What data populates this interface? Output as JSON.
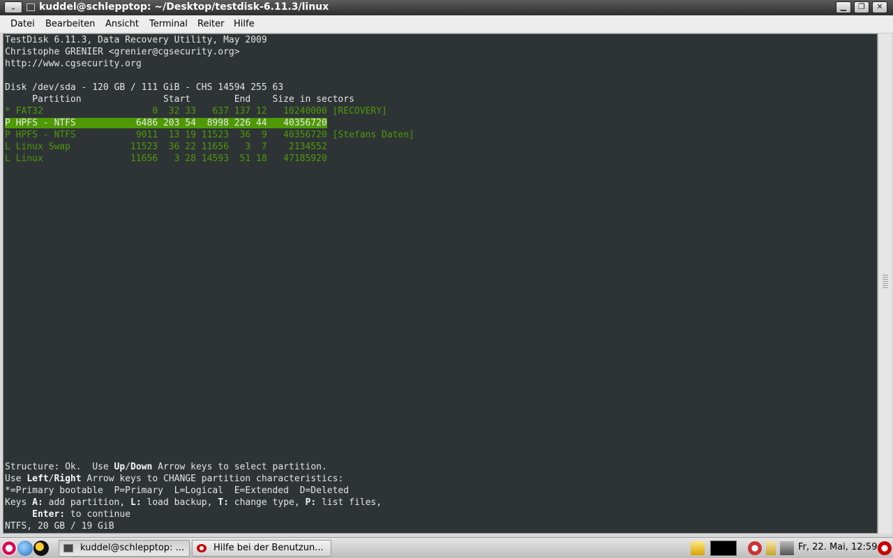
{
  "window": {
    "title": "kuddel@schlepptop: ~/Desktop/testdisk-6.11.3/linux",
    "menu_glyph": "⌄",
    "minimize_glyph": "▁",
    "maximize_glyph": "❐",
    "close_glyph": "✕"
  },
  "menubar": [
    "Datei",
    "Bearbeiten",
    "Ansicht",
    "Terminal",
    "Reiter",
    "Hilfe"
  ],
  "terminal": {
    "header": [
      "TestDisk 6.11.3, Data Recovery Utility, May 2009",
      "Christophe GRENIER <grenier@cgsecurity.org>",
      "http://www.cgsecurity.org"
    ],
    "disk_line": "Disk /dev/sda - 120 GB / 111 GiB - CHS 14594 255 63",
    "columns_line": "     Partition               Start        End    Size in sectors",
    "partitions": [
      {
        "row": "* FAT32                    0  32 33   637 137 12   10240000",
        "tag": " [RECOVERY]",
        "selected": false
      },
      {
        "row": "P HPFS - NTFS           6486 203 54  8998 226 44   40356720",
        "tag": "",
        "selected": true
      },
      {
        "row": "P HPFS - NTFS           9011  13 19 11523  36  9   40356720",
        "tag": " [Stefans Daten]",
        "selected": false
      },
      {
        "row": "L Linux Swap           11523  36 22 11656   3  7    2134552",
        "tag": "",
        "selected": false
      },
      {
        "row": "L Linux                11656   3 28 14593  51 18   47185920",
        "tag": "",
        "selected": false
      }
    ],
    "footer": {
      "l1_a": "Structure: Ok.  Use ",
      "l1_k1": "Up",
      "l1_b": "/",
      "l1_k2": "Down",
      "l1_c": " Arrow keys to select partition.",
      "l2_a": "Use ",
      "l2_k1": "Left",
      "l2_b": "/",
      "l2_k2": "Right",
      "l2_c": " Arrow keys to CHANGE partition characteristics:",
      "l3": "*=Primary bootable  P=Primary  L=Logical  E=Extended  D=Deleted",
      "l4_a": "Keys ",
      "l4_k1": "A:",
      "l4_b": " add partition, ",
      "l4_k2": "L:",
      "l4_c": " load backup, ",
      "l4_k3": "T:",
      "l4_d": " change type, ",
      "l4_k4": "P:",
      "l4_e": " list files,",
      "l5_a": "     ",
      "l5_k1": "Enter:",
      "l5_b": " to continue",
      "l6": "NTFS, 20 GB / 19 GiB"
    }
  },
  "taskbar": {
    "tasks": [
      "kuddel@schlepptop: ...",
      "Hilfe bei der Benutzun..."
    ],
    "clock": "Fr, 22. Mai, 12:59"
  },
  "colors": {
    "terminal_bg": "#2e3436",
    "partition_green": "#4e9a06",
    "terminal_text": "#e4e4e4"
  }
}
